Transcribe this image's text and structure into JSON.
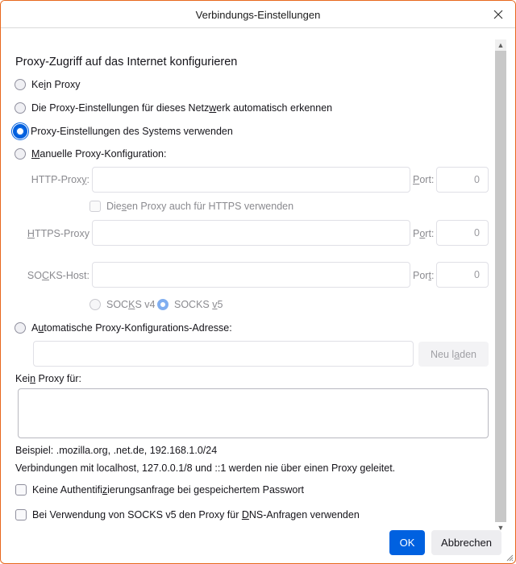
{
  "window": {
    "title": "Verbindungs-Einstellungen",
    "close_icon": "close-icon",
    "accent_color": "#0060df",
    "border_color": "#e8681d"
  },
  "section": {
    "heading": "Proxy-Zugriff auf das Internet konfigurieren"
  },
  "proxy_modes": [
    {
      "id": "no-proxy",
      "pre": "Ke",
      "u": "i",
      "post": "n Proxy",
      "checked": false
    },
    {
      "id": "auto-detect",
      "pre": "Die Proxy-Einstellungen für dieses Netz",
      "u": "w",
      "post": "erk automatisch erkennen",
      "checked": false
    },
    {
      "id": "system",
      "pre": "Proxy-Einstellungen des Systems verwenden",
      "u": "",
      "post": "",
      "checked": true
    },
    {
      "id": "manual",
      "pre": "",
      "u": "M",
      "post": "anuelle Proxy-Konfiguration:",
      "checked": false
    }
  ],
  "manual": {
    "http_label": {
      "pre": "HTTP-Prox",
      "u": "y",
      "post": ":"
    },
    "http_value": "",
    "http_port_label": {
      "pre": "",
      "u": "P",
      "post": "ort:"
    },
    "http_port": "0",
    "also_https": {
      "pre": "Die",
      "u": "s",
      "post": "en Proxy auch für HTTPS verwenden",
      "checked": false
    },
    "https_label": {
      "pre": "",
      "u": "H",
      "post": "TTPS-Proxy"
    },
    "https_value": "",
    "https_port_label": {
      "pre": "P",
      "u": "o",
      "post": "rt:"
    },
    "https_port": "0",
    "socks_label": {
      "pre": "SO",
      "u": "C",
      "post": "KS-Host:"
    },
    "socks_value": "",
    "socks_port_label": {
      "pre": "Por",
      "u": "t",
      "post": ":"
    },
    "socks_port": "0",
    "socks_v4": {
      "pre": "SOC",
      "u": "K",
      "post": "S v4",
      "checked": false
    },
    "socks_v5": {
      "pre": "SOCKS ",
      "u": "v",
      "post": "5",
      "checked": true
    }
  },
  "autoconfig": {
    "label": {
      "pre": "A",
      "u": "u",
      "post": "tomatische Proxy-Konfigurations-Adresse:"
    },
    "checked": false,
    "url_value": "",
    "reload_label": {
      "pre": "Neu l",
      "u": "a",
      "post": "den"
    }
  },
  "no_proxy": {
    "label": {
      "pre": "Kei",
      "u": "n",
      "post": " Proxy für:"
    },
    "value": "",
    "example": "Beispiel: .mozilla.org, .net.de, 192.168.1.0/24",
    "note": "Verbindungen mit localhost, 127.0.0.1/8 und ::1 werden nie über einen Proxy geleitet."
  },
  "options": [
    {
      "id": "no-auth-prompt",
      "pre": "Keine Authentifi",
      "u": "z",
      "post": "ierungsanfrage bei gespeichertem Passwort",
      "checked": false
    },
    {
      "id": "socks-dns",
      "pre": "Bei Verwendung von SOCKS v5 den Proxy für ",
      "u": "D",
      "post": "NS-Anfragen verwenden",
      "checked": false
    }
  ],
  "buttons": {
    "ok": "OK",
    "cancel": "Abbrechen"
  }
}
